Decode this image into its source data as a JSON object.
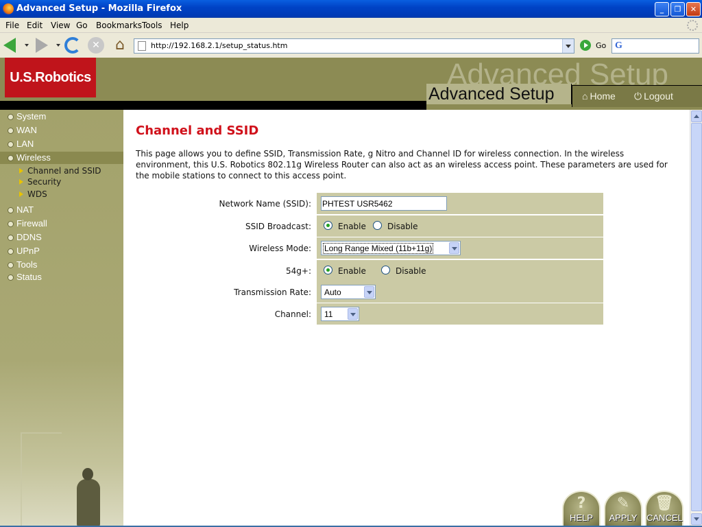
{
  "window": {
    "title": "Advanced Setup - Mozilla Firefox",
    "min_label": "_",
    "max_label": "❐",
    "close_label": "✕"
  },
  "menu": [
    "File",
    "Edit",
    "View",
    "Go",
    "Bookmarks",
    "Tools",
    "Help"
  ],
  "toolbar": {
    "url": "http://192.168.2.1/setup_status.htm",
    "go_label": "Go",
    "search_engine_glyph": "G",
    "stop_glyph": "✕",
    "home_glyph": "⌂"
  },
  "header": {
    "logo_text": "U.S.Robotics",
    "ghost_title": "Advanced Setup",
    "title": "Advanced Setup",
    "home_label": "Home",
    "logout_label": "Logout",
    "home_icon_glyph": "⌂",
    "logout_icon_glyph": "⏻"
  },
  "sidebar": {
    "items": [
      "System",
      "WAN",
      "LAN",
      "Wireless",
      "NAT",
      "Firewall",
      "DDNS",
      "UPnP",
      "Tools",
      "Status"
    ],
    "active": "Wireless",
    "subitems": [
      "Channel and SSID",
      "Security",
      "WDS"
    ]
  },
  "page": {
    "heading": "Channel and SSID",
    "description": "This page allows you to define SSID, Transmission Rate, g Nitro and Channel ID for wireless connection.  In the wireless environment, this U.S. Robotics 802.11g Wireless Router can also act as an wireless access point.  These parameters are used for the mobile stations to connect to this access point."
  },
  "form": {
    "ssid_label": "Network Name (SSID):",
    "ssid_value": "PHTEST USR5462",
    "broadcast_label": "SSID Broadcast:",
    "broadcast_enable": "Enable",
    "broadcast_disable": "Disable",
    "broadcast_selected": "Enable",
    "mode_label": "Wireless Mode:",
    "mode_value": "Long Range Mixed (11b+11g)",
    "g54_label": "54g+:",
    "g54_enable": "Enable",
    "g54_disable": "Disable",
    "g54_selected": "Enable",
    "rate_label": "Transmission Rate:",
    "rate_value": "Auto",
    "channel_label": "Channel:",
    "channel_value": "11"
  },
  "actions": {
    "help": "HELP",
    "apply": "APPLY",
    "cancel": "CANCEL",
    "help_glyph": "?",
    "apply_glyph": "✎",
    "cancel_glyph": "🗑"
  },
  "colors": {
    "accent_red": "#d0111b",
    "olive": "#8c8b54",
    "form_cell": "#cbcaa5"
  }
}
